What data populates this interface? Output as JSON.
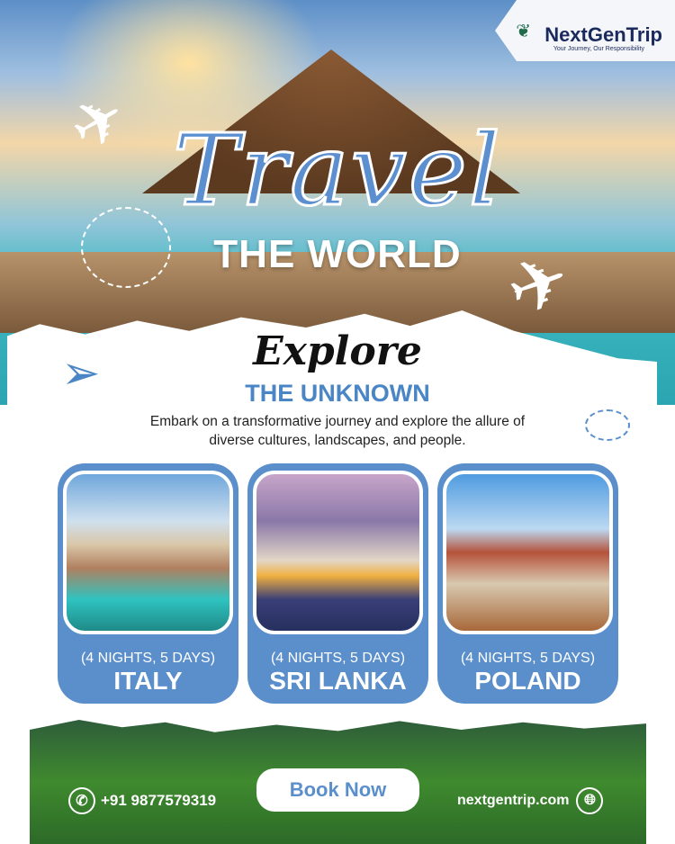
{
  "brand": {
    "name": "NextGenTrip",
    "tagline": "Your Journey, Our Responsibility"
  },
  "hero": {
    "title_script": "Travel",
    "subtitle": "THE WORLD"
  },
  "intro": {
    "script": "Explore",
    "heading": "THE UNKNOWN",
    "description": "Embark on a transformative journey and explore the allure of diverse cultures, landscapes, and people."
  },
  "packages": [
    {
      "duration": "(4 NIGHTS, 5 DAYS)",
      "destination": "ITALY"
    },
    {
      "duration": "(4 NIGHTS, 5 DAYS)",
      "destination": "SRI LANKA"
    },
    {
      "duration": "(4 NIGHTS, 5 DAYS)",
      "destination": "POLAND"
    }
  ],
  "footer": {
    "phone": "+91 9877579319",
    "cta": "Book Now",
    "website": "nextgentrip.com"
  },
  "colors": {
    "accent": "#5b8fcb",
    "heading": "#4a86c5"
  }
}
